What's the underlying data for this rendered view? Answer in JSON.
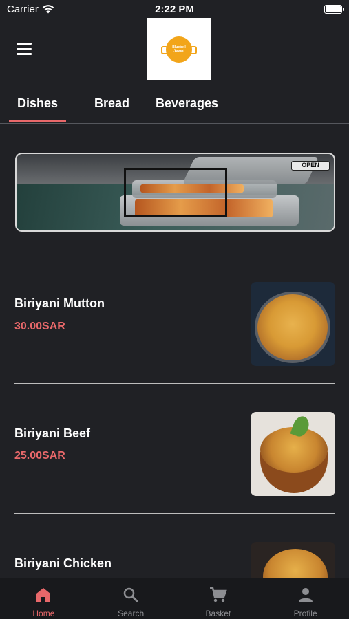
{
  "status_bar": {
    "carrier": "Carrier",
    "time": "2:22 PM"
  },
  "header": {
    "menu_icon": "hamburger-menu-icon",
    "logo_line1": "Bluebell",
    "logo_line2": "Jewel"
  },
  "tabs": [
    {
      "label": "Dishes",
      "active": true
    },
    {
      "label": "Bread",
      "active": false
    },
    {
      "label": "Beverages",
      "active": false
    }
  ],
  "banner": {
    "sign": "OPEN"
  },
  "items": [
    {
      "name": "Biriyani Mutton",
      "price": "30.00SAR"
    },
    {
      "name": "Biriyani Beef",
      "price": "25.00SAR"
    },
    {
      "name": "Biriyani Chicken",
      "price": ""
    }
  ],
  "bottom_nav": [
    {
      "label": "Home",
      "icon": "home-icon",
      "active": true
    },
    {
      "label": "Search",
      "icon": "search-icon",
      "active": false
    },
    {
      "label": "Basket",
      "icon": "cart-icon",
      "active": false
    },
    {
      "label": "Profile",
      "icon": "person-icon",
      "active": false
    }
  ],
  "colors": {
    "accent": "#e8686a",
    "background": "#202125",
    "nav_background": "#18191c"
  }
}
